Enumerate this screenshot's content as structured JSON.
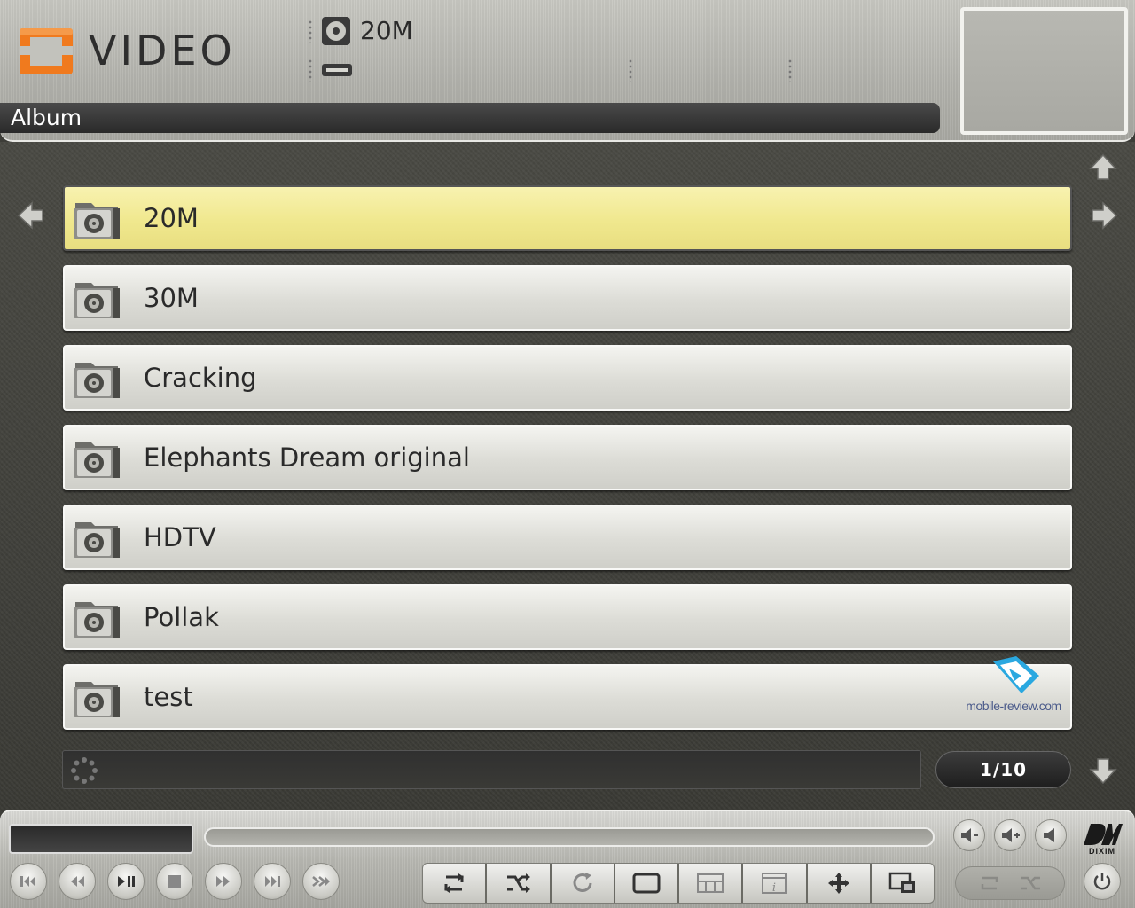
{
  "header": {
    "app_title": "VIDEO",
    "disc_label": "20M",
    "breadcrumb": "Album"
  },
  "list": {
    "items": [
      {
        "label": "20M",
        "selected": true
      },
      {
        "label": "30M",
        "selected": false
      },
      {
        "label": "Cracking",
        "selected": false
      },
      {
        "label": "Elephants Dream original",
        "selected": false
      },
      {
        "label": "HDTV",
        "selected": false
      },
      {
        "label": "Pollak",
        "selected": false
      },
      {
        "label": "test",
        "selected": false
      }
    ]
  },
  "watermark": {
    "text": "mobile-review.com"
  },
  "status": {
    "page_indicator": "1/10"
  },
  "controls": {
    "brand_text": "DIXIM",
    "transport": [
      "skip-back",
      "rewind",
      "play-pause",
      "stop",
      "fast-forward",
      "skip-forward",
      "step-forward"
    ],
    "toolbar": [
      "repeat",
      "shuffle",
      "refresh",
      "fullscreen",
      "grid-view",
      "info",
      "move",
      "picture-in-picture"
    ],
    "volume": [
      "volume-down",
      "volume-up",
      "mute"
    ]
  },
  "colors": {
    "selected_item": "#f0e88e",
    "logo_orange": "#f07a1e",
    "header_bg": "#b8b8b2",
    "main_bg": "#42423d"
  }
}
